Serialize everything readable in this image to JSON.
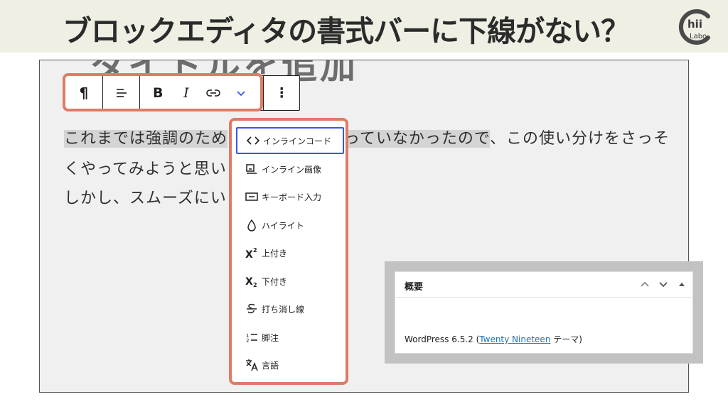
{
  "banner": {
    "title": "ブロックエディタの書式バーに下線がない？"
  },
  "logo": {
    "text_top": "hii",
    "text_bottom": "Labo"
  },
  "editor": {
    "ghost_title": "タイトルを追加",
    "toolbar": {
      "paragraph_label": "¶",
      "bold_label": "B",
      "italic_label": "I",
      "more_label": "⋮"
    },
    "paragraph": {
      "line1_selected_a": "これまでは強調のため",
      "line1_selected_b": "っていなかったので",
      "line1_rest": "、この使い分けをさっそ",
      "line2": "くやってみようと思い",
      "line3": "しかし、スムーズにい"
    },
    "dropdown": {
      "items": [
        {
          "label": "インラインコード",
          "icon": "code-icon",
          "active": true
        },
        {
          "label": "インライン画像",
          "icon": "image-icon",
          "active": false
        },
        {
          "label": "キーボード入力",
          "icon": "keyboard-icon",
          "active": false
        },
        {
          "label": "ハイライト",
          "icon": "droplet-icon",
          "active": false
        },
        {
          "label": "上付き",
          "icon": "superscript-icon",
          "active": false
        },
        {
          "label": "下付き",
          "icon": "subscript-icon",
          "active": false
        },
        {
          "label": "打ち消し線",
          "icon": "strikethrough-icon",
          "active": false
        },
        {
          "label": "脚注",
          "icon": "footnote-icon",
          "active": false
        },
        {
          "label": "言語",
          "icon": "language-icon",
          "active": false
        }
      ]
    }
  },
  "summary_panel": {
    "title": "概要",
    "version_prefix": "WordPress 6.5.2 (",
    "theme_link": "Twenty Nineteen",
    "theme_suffix": " テーマ)"
  },
  "colors": {
    "highlight": "#e07a66",
    "active_focus": "#3858e9",
    "link": "#2271b1",
    "banner_bg": "#efefe4"
  }
}
